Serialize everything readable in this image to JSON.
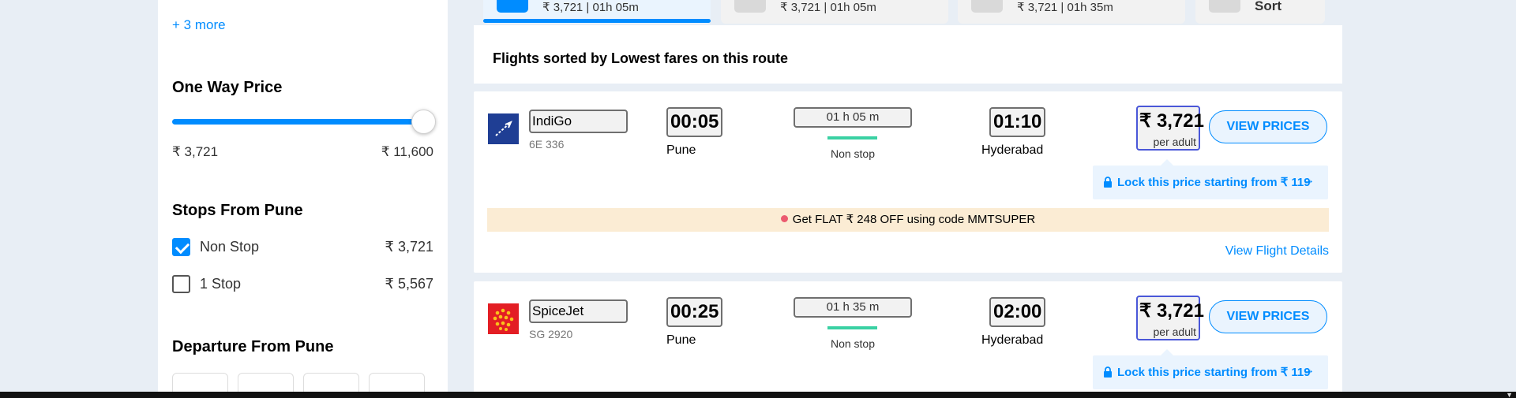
{
  "filters": {
    "more_link": "+ 3 more",
    "price": {
      "title": "One Way Price",
      "min_label": "₹ 3,721",
      "max_label": "₹ 11,600",
      "selected_fraction": 1.0
    },
    "stops": {
      "title": "Stops From Pune",
      "options": [
        {
          "label": "Non Stop",
          "price": "₹ 3,721",
          "checked": true
        },
        {
          "label": "1 Stop",
          "price": "₹ 5,567",
          "checked": false
        }
      ]
    },
    "departure": {
      "title": "Departure From Pune"
    }
  },
  "sort_tabs": [
    {
      "text": "₹ 3,721 | 01h 05m",
      "active": true,
      "icon": "cheapest-icon"
    },
    {
      "text": "₹ 3,721 | 01h 05m",
      "active": false,
      "icon": "fastest-icon"
    },
    {
      "text": "₹ 3,721 | 01h 35m",
      "active": false,
      "icon": "best-icon"
    },
    {
      "text": "Sort",
      "active": false,
      "icon": "sort-icon"
    }
  ],
  "sort_banner": "Flights sorted by Lowest fares on this route",
  "flights": [
    {
      "airline": "IndiGo",
      "flight_no": "6E 336",
      "logo": "indigo-logo",
      "dep_time": "00:05",
      "dep_city": "Pune",
      "duration": "01 h 05 m",
      "stops": "Non stop",
      "arr_time": "01:10",
      "arr_city": "Hyderabad",
      "price": "₹ 3,721",
      "per": "per adult",
      "button": "VIEW PRICES",
      "lock": "Lock this price starting from ₹ 119",
      "offer": "Get FLAT ₹ 248 OFF using code MMTSUPER",
      "details": "View Flight Details"
    },
    {
      "airline": "SpiceJet",
      "flight_no": "SG 2920",
      "logo": "spicejet-logo",
      "dep_time": "00:25",
      "dep_city": "Pune",
      "duration": "01 h 35 m",
      "stops": "Non stop",
      "arr_time": "02:00",
      "arr_city": "Hyderabad",
      "price": "₹ 3,721",
      "per": "per adult",
      "button": "VIEW PRICES",
      "lock": "Lock this price starting from ₹ 119"
    }
  ],
  "colors": {
    "accent": "#008cff",
    "page_bg": "#e8eef5",
    "offer_bg": "#fbecd4",
    "nonstop_line": "#3ad1a3",
    "indigo": "#1f3e94",
    "spicejet": "#e31e24"
  }
}
